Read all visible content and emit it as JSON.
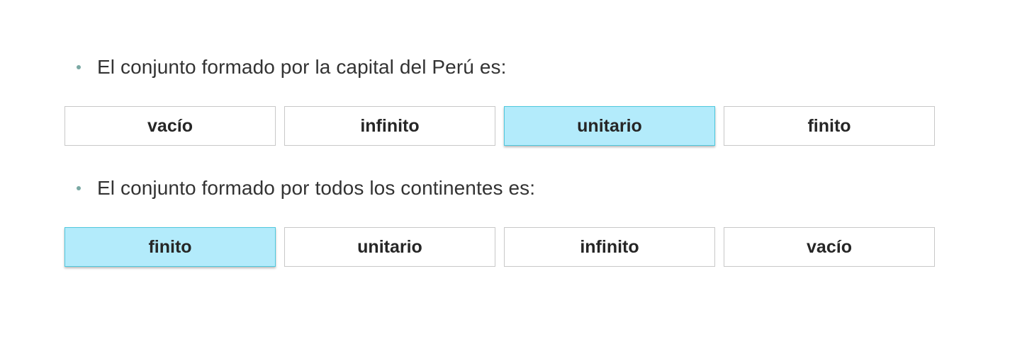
{
  "questions": [
    {
      "text": "El conjunto formado por la capital del Perú es:",
      "options": [
        {
          "label": "vacío",
          "selected": false
        },
        {
          "label": "infinito",
          "selected": false
        },
        {
          "label": "unitario",
          "selected": true
        },
        {
          "label": "finito",
          "selected": false
        }
      ]
    },
    {
      "text": "El conjunto formado por todos los continentes es:",
      "options": [
        {
          "label": "finito",
          "selected": true
        },
        {
          "label": "unitario",
          "selected": false
        },
        {
          "label": "infinito",
          "selected": false
        },
        {
          "label": "vacío",
          "selected": false
        }
      ]
    }
  ],
  "colors": {
    "selected_background": "#b3ebfb",
    "selected_border": "#4fc8dd",
    "bullet": "#7aa8a3"
  }
}
